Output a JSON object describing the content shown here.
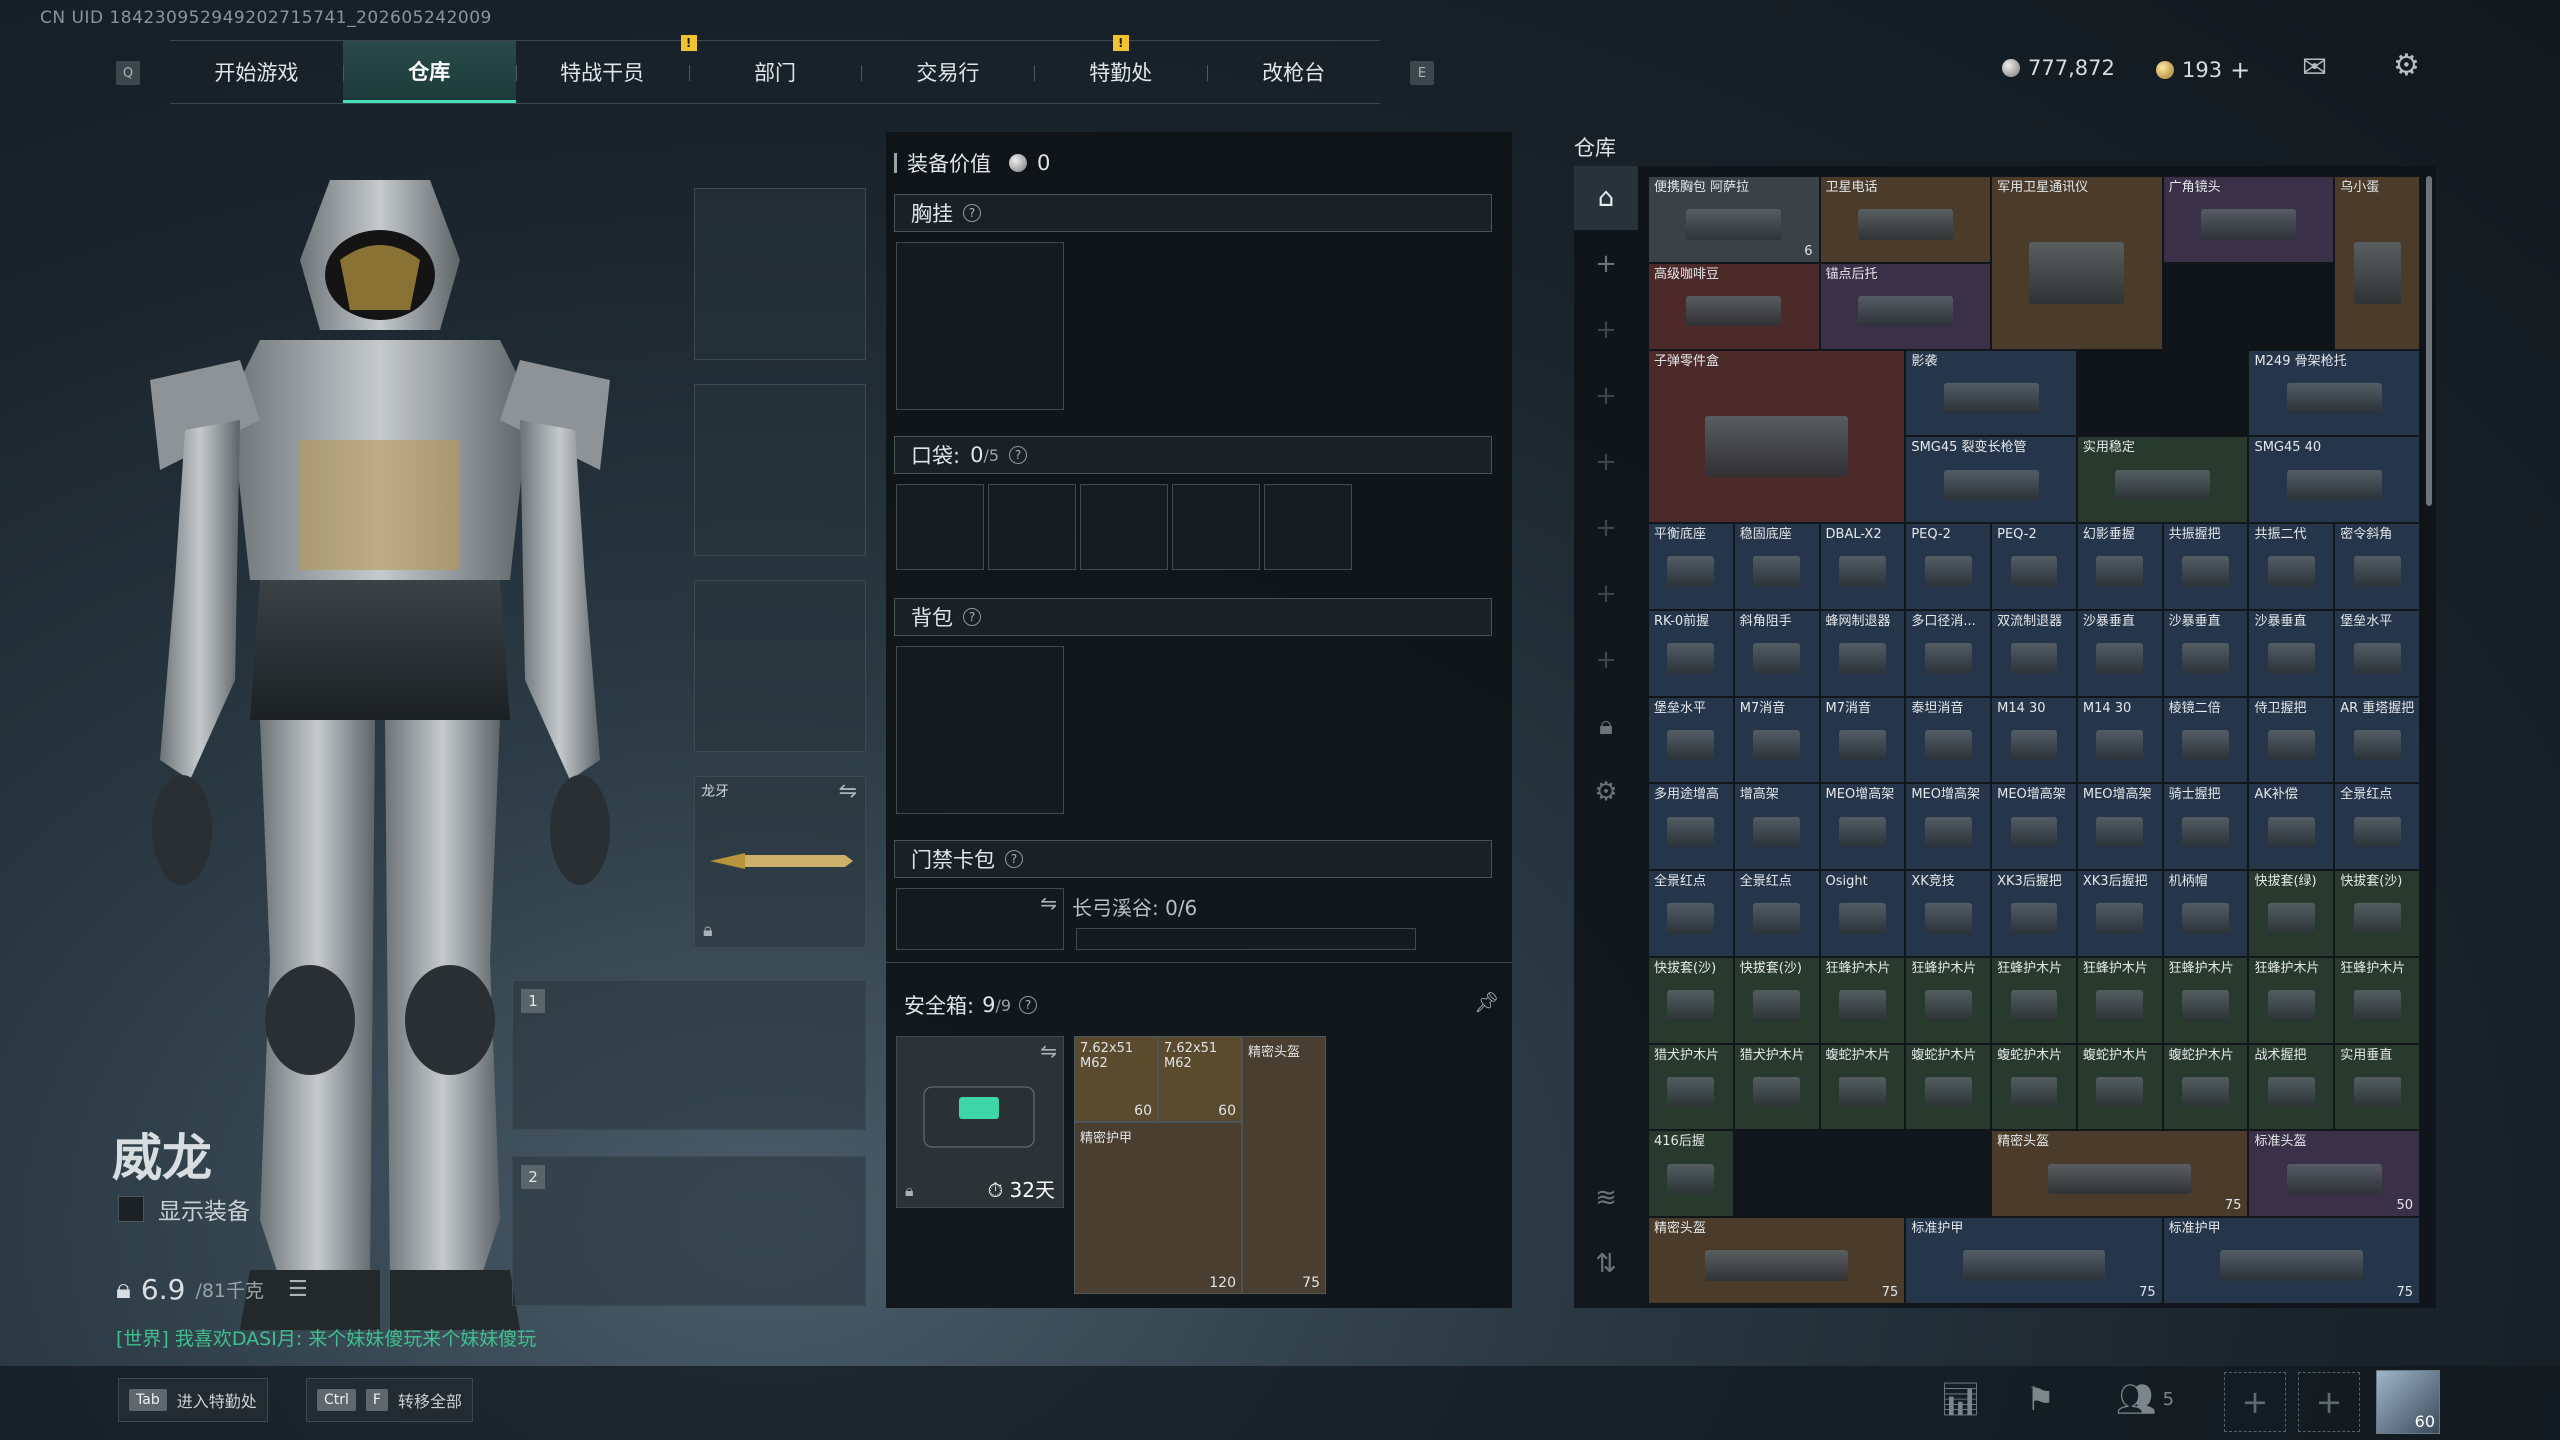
{
  "uid": "CN UID 184230952949202715741_202605242009",
  "nav": {
    "left_key": "Q",
    "right_key": "E",
    "tabs": [
      "开始游戏",
      "仓库",
      "特战干员",
      "部门",
      "交易行",
      "特勤处",
      "改枪台"
    ],
    "alert": "!"
  },
  "currency": {
    "silver": "777,872",
    "gold": "193",
    "plus": "+"
  },
  "character": {
    "name": "威龙",
    "show_equipment": "显示装备",
    "weight": "6.9",
    "weight_max": "/81千克",
    "melee": "龙牙",
    "weapon_slot_1": "1",
    "weapon_slot_2": "2"
  },
  "chat": "[世界] 我喜欢DASI月: 来个妹妹傻玩来个妹妹傻玩",
  "mid": {
    "value_label": "装备价值",
    "value": "0",
    "chest": "胸挂",
    "pocket": "口袋:",
    "pocket_count": "0",
    "pocket_max": "/5",
    "backpack": "背包",
    "keycard": "门禁卡包",
    "keycard_info": "长弓溪谷: 0/6",
    "safebox": "安全箱:",
    "safebox_count": "9",
    "safebox_max": "/9",
    "safebox_days": "32天",
    "safebox_items": [
      {
        "name": "7.62x51 M62",
        "count": "60"
      },
      {
        "name": "7.62x51 M62",
        "count": "60"
      },
      {
        "name": "精密头盔",
        "count": ""
      },
      {
        "name": "精密护甲",
        "count": "120"
      },
      {
        "name": "",
        "count": "75"
      }
    ]
  },
  "inventory": {
    "title": "仓库",
    "items": [
      {
        "name": "便携胸包 阿萨拉",
        "count": "6",
        "c": "c-gray",
        "col": 0,
        "row": 0,
        "w": 2,
        "h": 1
      },
      {
        "name": "卫星电话",
        "count": "",
        "c": "c-gold",
        "col": 2,
        "row": 0,
        "w": 2,
        "h": 1
      },
      {
        "name": "军用卫星通讯仪",
        "count": "",
        "c": "c-gold",
        "col": 4,
        "row": 0,
        "w": 2,
        "h": 2
      },
      {
        "name": "广角镜头",
        "count": "",
        "c": "c-purple",
        "col": 6,
        "row": 0,
        "w": 2,
        "h": 1
      },
      {
        "name": "乌小蛋",
        "count": "",
        "c": "c-gold",
        "col": 8,
        "row": 0,
        "w": 1,
        "h": 2
      },
      {
        "name": "高级咖啡豆",
        "count": "",
        "c": "c-red",
        "col": 0,
        "row": 1,
        "w": 2,
        "h": 1
      },
      {
        "name": "锚点后托",
        "count": "",
        "c": "c-purple",
        "col": 2,
        "row": 1,
        "w": 2,
        "h": 1
      },
      {
        "name": "子弹零件盒",
        "count": "",
        "c": "c-red",
        "col": 0,
        "row": 2,
        "w": 3,
        "h": 2
      },
      {
        "name": "影袭",
        "count": "",
        "c": "c-blue",
        "col": 3,
        "row": 2,
        "w": 2,
        "h": 1
      },
      {
        "name": "M249 骨架枪托",
        "count": "",
        "c": "c-blue",
        "col": 7,
        "row": 2,
        "w": 2,
        "h": 1
      },
      {
        "name": "SMG45 裂变长枪管",
        "count": "",
        "c": "c-blue",
        "col": 3,
        "row": 3,
        "w": 2,
        "h": 1
      },
      {
        "name": "实用稳定",
        "count": "",
        "c": "c-green",
        "col": 5,
        "row": 3,
        "w": 2,
        "h": 1
      },
      {
        "name": "SMG45 40",
        "count": "",
        "c": "c-blue",
        "col": 7,
        "row": 3,
        "w": 2,
        "h": 1
      },
      {
        "name": "平衡底座",
        "c": "c-blue",
        "col": 0,
        "row": 4
      },
      {
        "name": "稳固底座",
        "c": "c-blue",
        "col": 1,
        "row": 4
      },
      {
        "name": "DBAL-X2",
        "c": "c-blue",
        "col": 2,
        "row": 4
      },
      {
        "name": "PEQ-2",
        "c": "c-blue",
        "col": 3,
        "row": 4
      },
      {
        "name": "PEQ-2",
        "c": "c-blue",
        "col": 4,
        "row": 4
      },
      {
        "name": "幻影垂握",
        "c": "c-blue",
        "col": 5,
        "row": 4
      },
      {
        "name": "共振握把",
        "c": "c-blue",
        "col": 6,
        "row": 4
      },
      {
        "name": "共振二代",
        "c": "c-blue",
        "col": 7,
        "row": 4
      },
      {
        "name": "密令斜角",
        "c": "c-blue",
        "col": 8,
        "row": 4
      },
      {
        "name": "RK-0前握",
        "c": "c-blue",
        "col": 0,
        "row": 5
      },
      {
        "name": "斜角阻手",
        "c": "c-blue",
        "col": 1,
        "row": 5
      },
      {
        "name": "蜂网制退器",
        "c": "c-blue",
        "col": 2,
        "row": 5
      },
      {
        "name": "多口径消...",
        "c": "c-blue",
        "col": 3,
        "row": 5
      },
      {
        "name": "双流制退器",
        "c": "c-blue",
        "col": 4,
        "row": 5
      },
      {
        "name": "沙暴垂直",
        "c": "c-blue",
        "col": 5,
        "row": 5
      },
      {
        "name": "沙暴垂直",
        "c": "c-blue",
        "col": 6,
        "row": 5
      },
      {
        "name": "沙暴垂直",
        "c": "c-blue",
        "col": 7,
        "row": 5
      },
      {
        "name": "堡垒水平",
        "c": "c-blue",
        "col": 8,
        "row": 5
      },
      {
        "name": "堡垒水平",
        "c": "c-blue",
        "col": 0,
        "row": 6
      },
      {
        "name": "M7消音",
        "c": "c-blue",
        "col": 1,
        "row": 6
      },
      {
        "name": "M7消音",
        "c": "c-blue",
        "col": 2,
        "row": 6
      },
      {
        "name": "泰坦消音",
        "c": "c-blue",
        "col": 3,
        "row": 6
      },
      {
        "name": "M14 30",
        "c": "c-blue",
        "col": 4,
        "row": 6
      },
      {
        "name": "M14 30",
        "c": "c-blue",
        "col": 5,
        "row": 6
      },
      {
        "name": "棱镜二倍",
        "c": "c-blue",
        "col": 6,
        "row": 6
      },
      {
        "name": "侍卫握把",
        "c": "c-blue",
        "col": 7,
        "row": 6
      },
      {
        "name": "AR 重塔握把",
        "c": "c-blue",
        "col": 8,
        "row": 6
      },
      {
        "name": "多用途增高",
        "c": "c-blue",
        "col": 0,
        "row": 7
      },
      {
        "name": "增高架",
        "c": "c-blue",
        "col": 1,
        "row": 7
      },
      {
        "name": "MEO增高架",
        "c": "c-blue",
        "col": 2,
        "row": 7
      },
      {
        "name": "MEO增高架",
        "c": "c-blue",
        "col": 3,
        "row": 7
      },
      {
        "name": "MEO增高架",
        "c": "c-blue",
        "col": 4,
        "row": 7
      },
      {
        "name": "MEO增高架",
        "c": "c-blue",
        "col": 5,
        "row": 7
      },
      {
        "name": "骑士握把",
        "c": "c-blue",
        "col": 6,
        "row": 7
      },
      {
        "name": "AK补偿",
        "c": "c-blue",
        "col": 7,
        "row": 7
      },
      {
        "name": "全景红点",
        "c": "c-blue",
        "col": 8,
        "row": 7
      },
      {
        "name": "全景红点",
        "c": "c-blue",
        "col": 0,
        "row": 8
      },
      {
        "name": "全景红点",
        "c": "c-blue",
        "col": 1,
        "row": 8
      },
      {
        "name": "Osight",
        "c": "c-blue",
        "col": 2,
        "row": 8
      },
      {
        "name": "XK竞技",
        "c": "c-blue",
        "col": 3,
        "row": 8
      },
      {
        "name": "XK3后握把",
        "c": "c-blue",
        "col": 4,
        "row": 8
      },
      {
        "name": "XK3后握把",
        "c": "c-blue",
        "col": 5,
        "row": 8
      },
      {
        "name": "机柄帽",
        "c": "c-blue",
        "col": 6,
        "row": 8
      },
      {
        "name": "快拔套(绿)",
        "c": "c-green",
        "col": 7,
        "row": 8
      },
      {
        "name": "快拔套(沙)",
        "c": "c-green",
        "col": 8,
        "row": 8
      },
      {
        "name": "快拔套(沙)",
        "c": "c-green",
        "col": 0,
        "row": 9
      },
      {
        "name": "快拔套(沙)",
        "c": "c-green",
        "col": 1,
        "row": 9
      },
      {
        "name": "狂蜂护木片",
        "c": "c-green",
        "col": 2,
        "row": 9
      },
      {
        "name": "狂蜂护木片",
        "c": "c-green",
        "col": 3,
        "row": 9
      },
      {
        "name": "狂蜂护木片",
        "c": "c-green",
        "col": 4,
        "row": 9
      },
      {
        "name": "狂蜂护木片",
        "c": "c-green",
        "col": 5,
        "row": 9
      },
      {
        "name": "狂蜂护木片",
        "c": "c-green",
        "col": 6,
        "row": 9
      },
      {
        "name": "狂蜂护木片",
        "c": "c-green",
        "col": 7,
        "row": 9
      },
      {
        "name": "狂蜂护木片",
        "c": "c-green",
        "col": 8,
        "row": 9
      },
      {
        "name": "猎犬护木片",
        "c": "c-green",
        "col": 0,
        "row": 10
      },
      {
        "name": "猎犬护木片",
        "c": "c-green",
        "col": 1,
        "row": 10
      },
      {
        "name": "蝮蛇护木片",
        "c": "c-green",
        "col": 2,
        "row": 10
      },
      {
        "name": "蝮蛇护木片",
        "c": "c-green",
        "col": 3,
        "row": 10
      },
      {
        "name": "蝮蛇护木片",
        "c": "c-green",
        "col": 4,
        "row": 10
      },
      {
        "name": "蝮蛇护木片",
        "c": "c-green",
        "col": 5,
        "row": 10
      },
      {
        "name": "蝮蛇护木片",
        "c": "c-green",
        "col": 6,
        "row": 10
      },
      {
        "name": "战术握把",
        "c": "c-green",
        "col": 7,
        "row": 10
      },
      {
        "name": "实用垂直",
        "c": "c-green",
        "col": 8,
        "row": 10
      },
      {
        "name": "416后握",
        "c": "c-green",
        "col": 0,
        "row": 11
      },
      {
        "name": "精密头盔",
        "count": "75",
        "c": "c-gold",
        "col": 4,
        "row": 11,
        "w": 3,
        "h": 1
      },
      {
        "name": "标准头盔",
        "count": "50",
        "c": "c-purple",
        "col": 7,
        "row": 11,
        "w": 2,
        "h": 1
      },
      {
        "name": "精密头盔",
        "count": "75",
        "c": "c-gold",
        "col": 0,
        "row": 12,
        "w": 3,
        "h": 1
      },
      {
        "name": "标准护甲",
        "count": "75",
        "c": "c-blue",
        "col": 3,
        "row": 12,
        "w": 3,
        "h": 1
      },
      {
        "name": "标准护甲",
        "count": "75",
        "c": "c-blue",
        "col": 6,
        "row": 12,
        "w": 3,
        "h": 1
      }
    ]
  },
  "bottom": {
    "tab_key": "Tab",
    "tab_label": "进入特勤处",
    "ctrl_key": "Ctrl",
    "f_key": "F",
    "ctrl_label": "转移全部",
    "friends": "5",
    "avatar_level": "60"
  }
}
